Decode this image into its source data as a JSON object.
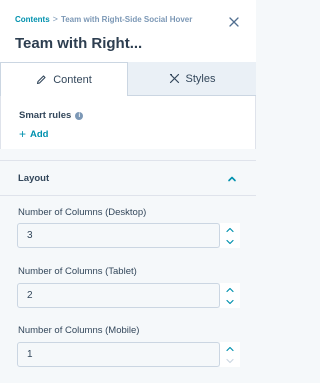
{
  "header": {
    "breadcrumb_root": "Contents",
    "breadcrumb_sep": ">",
    "breadcrumb_current": "Team with Right-Side Social Hover",
    "title": "Team with Right..."
  },
  "tabs": [
    {
      "label": "Content",
      "icon": "pencil-icon",
      "active": true
    },
    {
      "label": "Styles",
      "icon": "paint-tools-icon",
      "active": false
    }
  ],
  "smart_rules": {
    "label": "Smart rules",
    "info_icon": "info-icon",
    "add_label": "Add"
  },
  "layout": {
    "title": "Layout",
    "expanded": true,
    "fields": [
      {
        "label": "Number of Columns (Desktop)",
        "value": "3"
      },
      {
        "label": "Number of Columns (Tablet)",
        "value": "2"
      },
      {
        "label": "Number of Columns (Mobile)",
        "value": "1"
      }
    ]
  },
  "colors": {
    "link": "#0091ae",
    "text": "#33475b",
    "border": "#cbd6e2",
    "panel_bg": "#f5f8fa"
  }
}
